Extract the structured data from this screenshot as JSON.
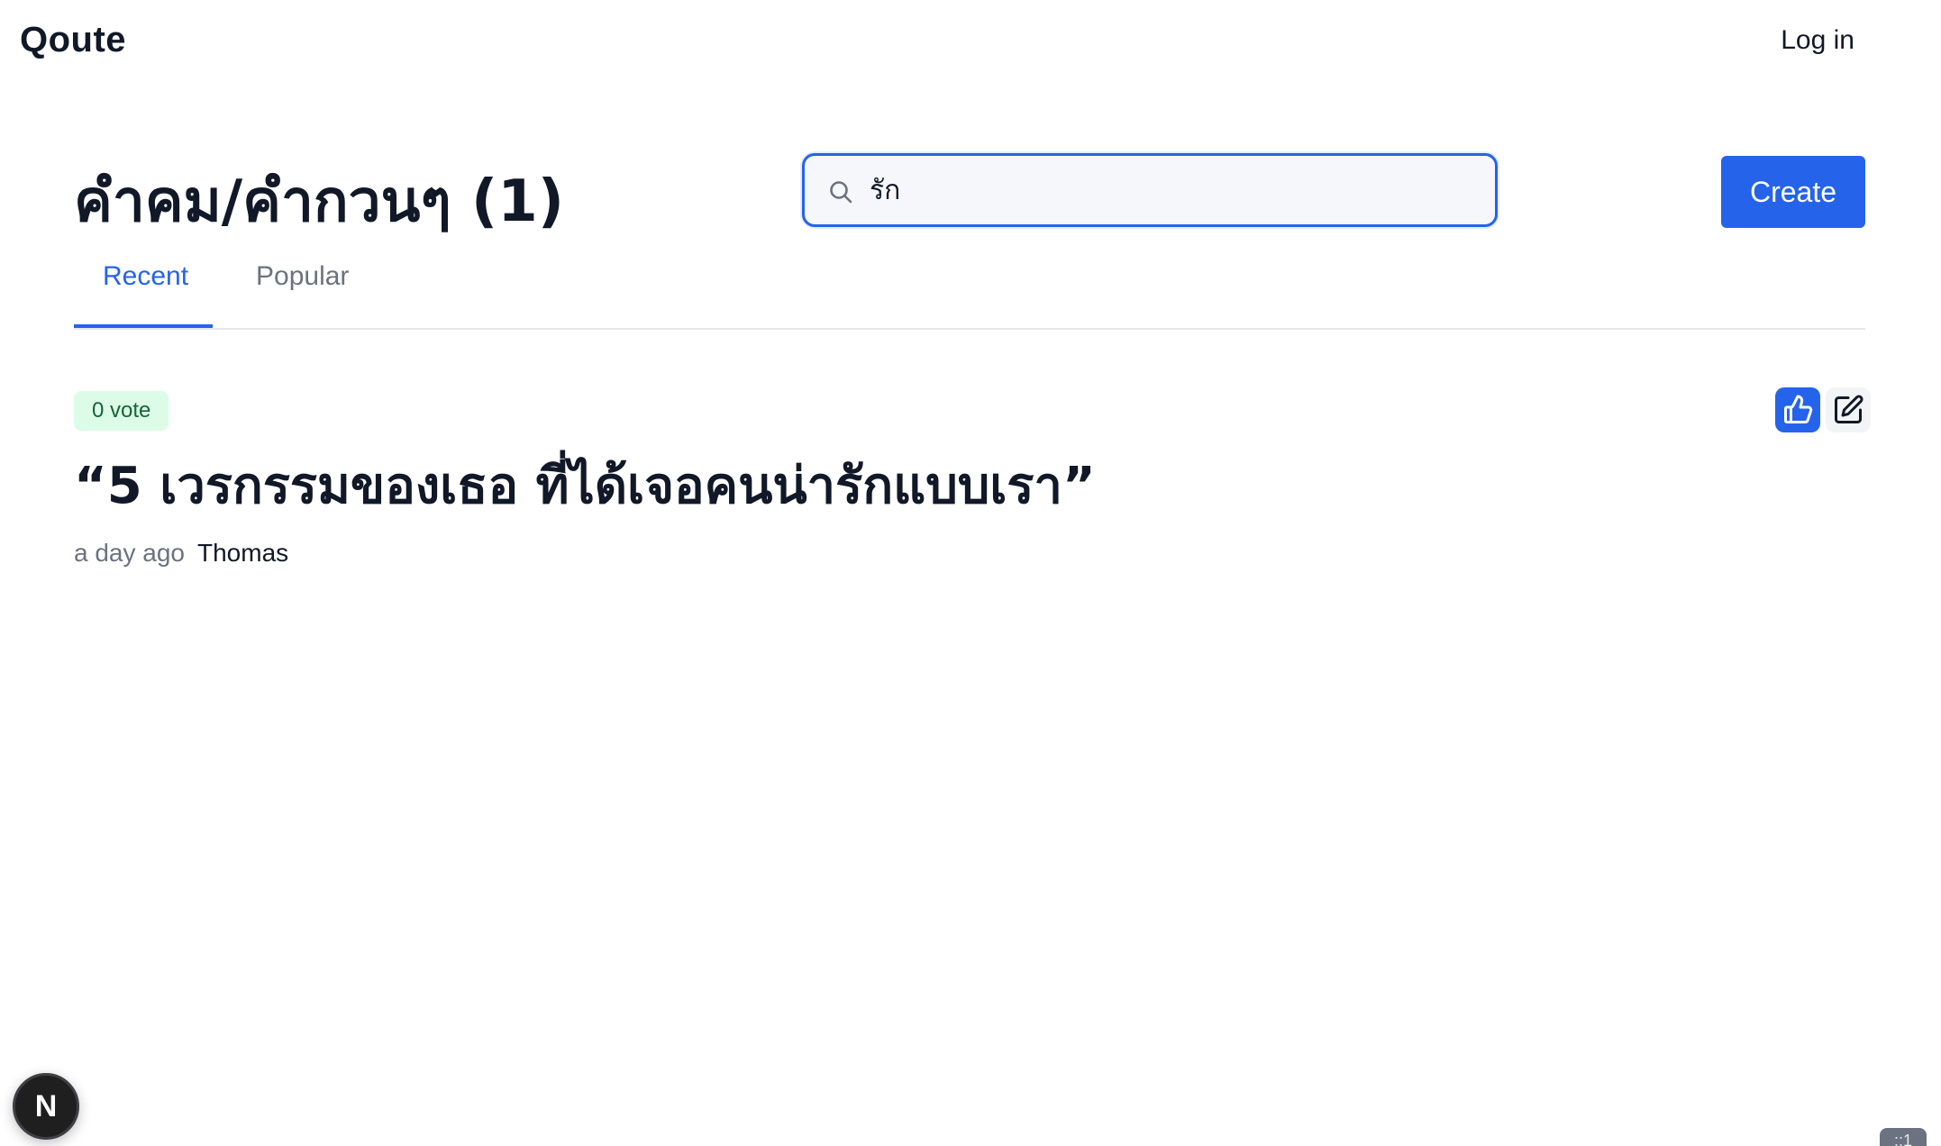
{
  "navbar": {
    "brand": "Qoute",
    "login_label": "Log in"
  },
  "header": {
    "title": "คำคม/คำกวนๆ (1)",
    "create_label": "Create"
  },
  "search": {
    "value": "รัก",
    "icon": "search-icon"
  },
  "tabs": [
    {
      "label": "Recent",
      "active": true
    },
    {
      "label": "Popular",
      "active": false
    }
  ],
  "quotes": [
    {
      "votes": "0 vote",
      "text": "“5 เวรกรรมของเธอ ที่ได้เจอคนน่ารักแบบเรา”",
      "time": "a day ago",
      "author": "Thomas",
      "actions": [
        "thumbs-up-icon",
        "edit-icon"
      ]
    }
  ],
  "dev_badge": {
    "label": "N"
  },
  "corner_tag": {
    "label": "::1"
  },
  "colors": {
    "primary": "#2563eb",
    "vote_bg": "#dcfce7",
    "vote_text": "#166534",
    "text": "#111827",
    "muted": "#6b7280"
  }
}
